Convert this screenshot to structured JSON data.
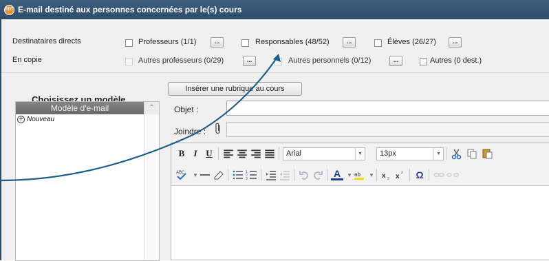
{
  "window": {
    "title": "E-mail destiné aux personnes concernées par le(s) cours",
    "logo_text": "EDT"
  },
  "recipients": {
    "direct_label": "Destinataires directs",
    "cc_label": "En copie",
    "direct": [
      {
        "label": "Professeurs (1/1)",
        "checked": false
      },
      {
        "label": "Responsables (48/52)",
        "checked": false
      },
      {
        "label": "Élèves (26/27)",
        "checked": false
      }
    ],
    "cc": [
      {
        "label": "Autres professeurs (0/29)",
        "checked": false
      },
      {
        "label": "Autres personnels (0/12)",
        "checked": false
      },
      {
        "label": "Autres (0 dest.)",
        "checked": false
      }
    ],
    "more_button": "..."
  },
  "template": {
    "heading": "Choisissez un modèle",
    "list_header": "Modèle d'e-mail",
    "items": [
      "Nouveau"
    ]
  },
  "compose": {
    "insert_button": "Insérer une rubrique au cours",
    "subject_label": "Objet :",
    "subject_value": "",
    "attach_label": "Joindre :",
    "attach_value": ""
  },
  "editor": {
    "font": "Arial",
    "size": "13px",
    "bold": "B",
    "italic": "I",
    "underline": "U",
    "text_color": "A"
  },
  "colors": {
    "titlebar": "#2e4d6b",
    "arrow": "#1f5f8b"
  }
}
